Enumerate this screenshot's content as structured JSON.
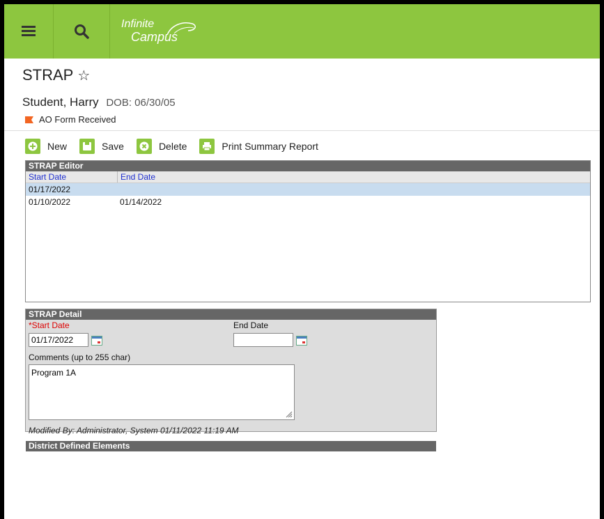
{
  "app": {
    "logo_line1": "Infinite",
    "logo_line2": "Campus",
    "brand_color": "#8dc63f"
  },
  "header": {
    "title": "STRAP",
    "student_name": "Student, Harry",
    "dob": "DOB: 06/30/05",
    "flag_text": "AO Form Received",
    "flag_color": "#f26522"
  },
  "toolbar": {
    "new_label": "New",
    "save_label": "Save",
    "delete_label": "Delete",
    "print_label": "Print Summary Report"
  },
  "editor": {
    "title": "STRAP Editor",
    "columns": [
      "Start Date",
      "End Date"
    ],
    "rows": [
      {
        "start": "01/17/2022",
        "end": ""
      },
      {
        "start": "01/10/2022",
        "end": "01/14/2022"
      }
    ]
  },
  "detail": {
    "title": "STRAP Detail",
    "start_label": "*Start Date",
    "start_value": "01/17/2022",
    "end_label": "End Date",
    "end_value": "",
    "comments_label": "Comments (up to 255 char)",
    "comments_value": "Program 1A",
    "modified": "Modified By: Administrator, System 01/11/2022 11:19 AM",
    "district_header": "District Defined Elements"
  }
}
